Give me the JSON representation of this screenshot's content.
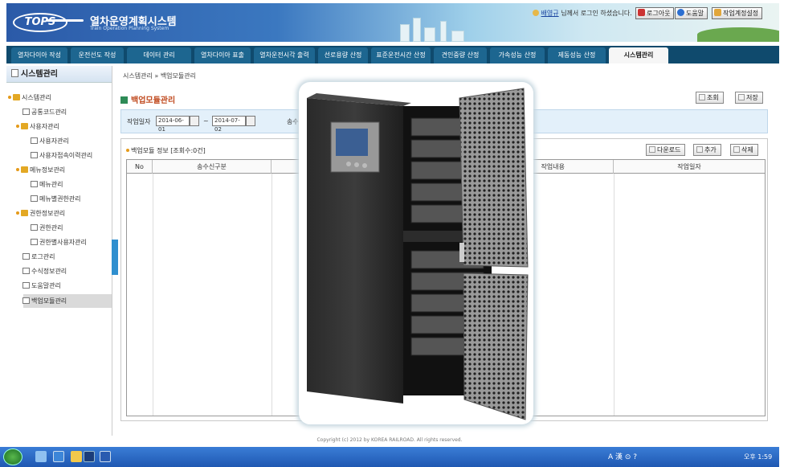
{
  "header": {
    "logo": "TOPS",
    "title": "열차운영계획시스템",
    "subtitle": "Train Operation Planning System",
    "user_name": "배영규",
    "user_suffix": "님께서 로그인 하셨습니다.",
    "logout": "로그아웃",
    "help": "도움말",
    "settings": "작업계정설정"
  },
  "menu": [
    "열차다이아 작성",
    "운전선도 작성",
    "데이터 관리",
    "열차다이아 표출",
    "열차운전시각 출력",
    "선로용량 산정",
    "표준운전시간 산정",
    "견인중량 산정",
    "가속성능 산정",
    "제동성능 산정",
    "시스템관리"
  ],
  "sidebar": {
    "title": "시스템관리",
    "items": [
      "시스템관리",
      "공통코드관리",
      "사용자관리",
      "사용자관리",
      "사용자접속이력관리",
      "메뉴정보관리",
      "메뉴관리",
      "메뉴별권한관리",
      "권한정보관리",
      "권한관리",
      "권한별사용자관리",
      "로그관리",
      "수식정보관리",
      "도움말관리",
      "백업모듈관리"
    ]
  },
  "breadcrumb": {
    "root": "시스템관리",
    "sep": "»",
    "current": "백업모듈관리"
  },
  "page": {
    "title": "백업모듈관리",
    "search_btn": "조회",
    "save_btn": "저장",
    "date_label": "작업일자",
    "date_from": "2014-06-01",
    "date_to": "2014-07-02",
    "date_sep": "~",
    "extra_label": "송수"
  },
  "list": {
    "title": "백업모듈 정보 [조회수:0건]",
    "download": "다운로드",
    "add": "추가",
    "delete": "삭제",
    "columns": [
      "No",
      "송수신구분",
      "작업내용",
      "작업일자"
    ]
  },
  "footer": "Copyright (c) 2012 by KOREA RAILROAD. All rights reserved.",
  "taskbar": {
    "tray": "A 漢 ⊙ ?",
    "clock": "오후 1:59"
  },
  "colors": {
    "menubar": "#0f4a6d",
    "menu_tab": "#1d6690",
    "title_accent": "#c04a1f",
    "search_bg": "#e3f0fa"
  }
}
